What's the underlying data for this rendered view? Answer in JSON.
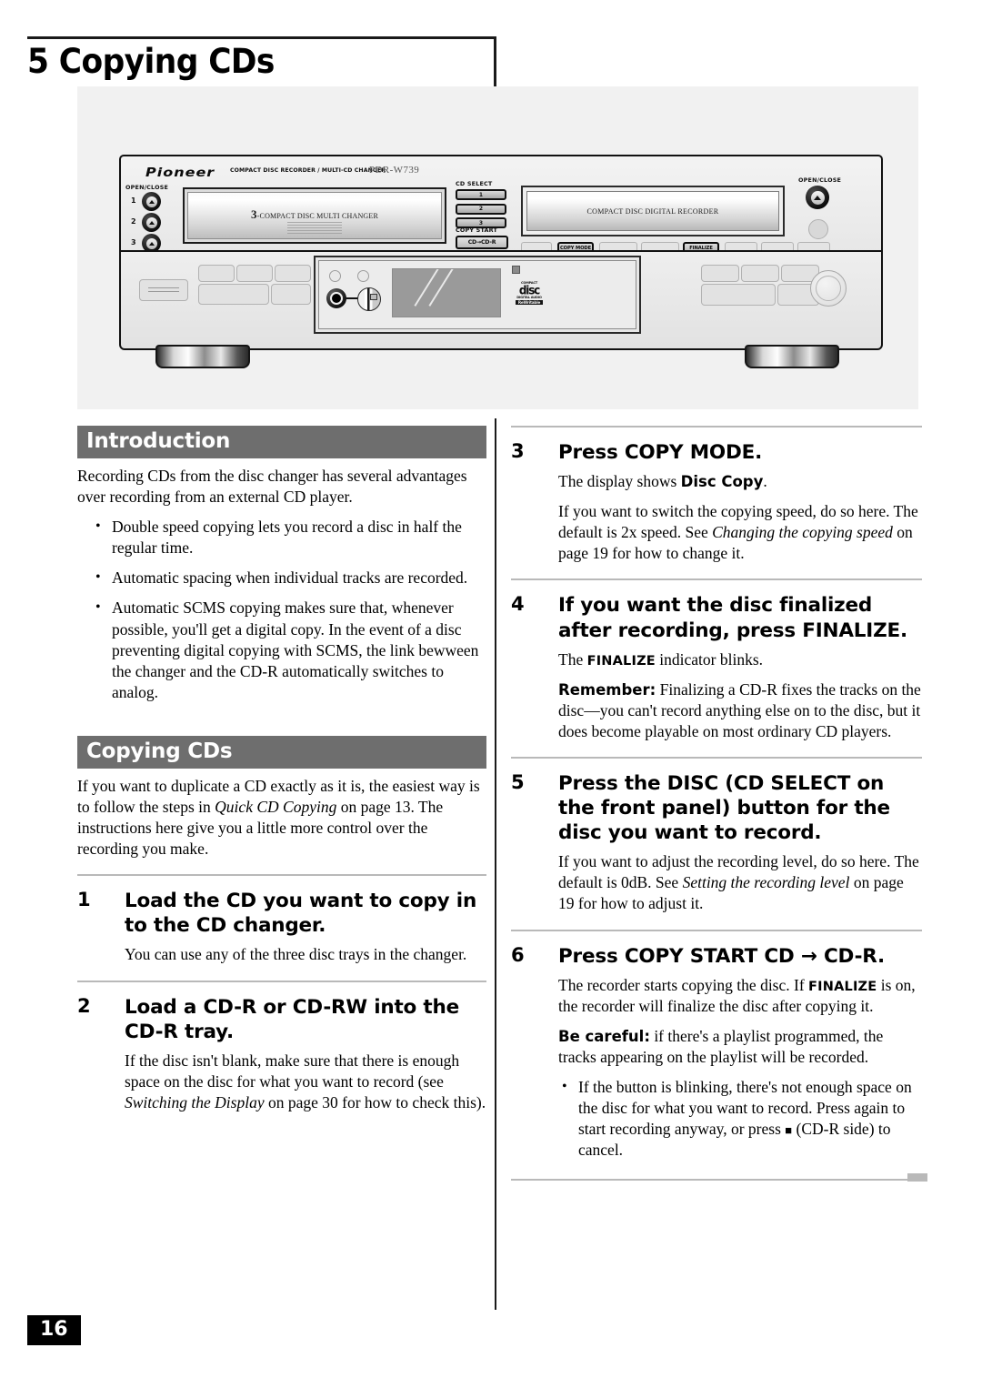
{
  "chapter": {
    "number_and_title": "5 Copying CDs"
  },
  "illustration": {
    "brand": "Pioneer",
    "brand_subtitle": "COMPACT DISC RECORDER / MULTI-CD CHANGER",
    "model": "PDR-W739",
    "open_close_left_label": "OPEN/CLOSE",
    "tray_numbers": [
      "1",
      "2",
      "3"
    ],
    "changer_tray_prefix": "3",
    "changer_tray_label": "-COMPACT DISC MULTI CHANGER",
    "cd_select_label": "CD SELECT",
    "cd_select_buttons": [
      "1",
      "2",
      "3"
    ],
    "copy_start_label": "COPY START",
    "copy_start_button": "CD→CD-R",
    "recorder_tray_label": "COMPACT DISC DIGITAL RECORDER",
    "copy_mode_button": "COPY MODE",
    "finalize_button": "FINALIZE",
    "open_close_right_label": "OPEN/CLOSE",
    "cd_logo_top": "COMPACT",
    "cd_logo_main": "disc",
    "cd_logo_bottom": "DIGITAL AUDIO",
    "cd_logo_rewritable": "ReWritable"
  },
  "left_column": {
    "intro": {
      "heading": "Introduction",
      "paragraph": "Recording CDs from the disc changer has several advantages over recording from an external CD player.",
      "bullets": [
        "Double speed copying lets you record a disc in half the regular time.",
        "Automatic spacing when individual tracks are recorded.",
        "Automatic SCMS copying makes sure that, whenever possible, you'll get a digital copy. In the event of a disc preventing digital copying with SCMS, the link bewween the changer and the CD-R automatically switches to analog."
      ]
    },
    "copying": {
      "heading": "Copying CDs",
      "paragraph_part1": "If you want to duplicate a CD exactly as it is, the easiest way is to follow the steps in ",
      "paragraph_italic": "Quick CD Copying",
      "paragraph_part2": " on page 13. The instructions here give you a little more control over the recording you make."
    },
    "steps": [
      {
        "number": "1",
        "heading": "Load the CD you want to copy in to the CD changer.",
        "body": "You can use any of the three disc trays in the changer."
      },
      {
        "number": "2",
        "heading": "Load a CD-R or CD-RW into the CD-R tray.",
        "body_part1": "If the disc isn't blank, make sure that there is enough space on the disc for what you want to record (see ",
        "body_italic": "Switching the Display",
        "body_part2": " on page 30 for how to check this)."
      }
    ]
  },
  "right_column": {
    "steps": [
      {
        "number": "3",
        "heading": "Press COPY MODE.",
        "body1_part1": "The display shows ",
        "body1_bold": "Disc Copy",
        "body1_part2": ".",
        "body2_part1": "If you want to switch the copying speed, do so here. The default is 2x speed. See ",
        "body2_italic": "Changing the copying speed",
        "body2_part2": " on page 19 for how to change it."
      },
      {
        "number": "4",
        "heading": "If you want the disc finalized after recording, press FINALIZE.",
        "body1_part1": "The ",
        "body1_sc": "FINALIZE",
        "body1_part2": " indicator blinks.",
        "body2_bold": "Remember:",
        "body2_text": " Finalizing a CD-R fixes the tracks on the disc—you can't record anything else on to the disc, but it does become playable on most ordinary CD players."
      },
      {
        "number": "5",
        "heading": "Press the DISC (CD SELECT on the front panel) button for the disc you want to record.",
        "body1_part1": "If you want to adjust the recording level, do so here. The default is 0dB. See ",
        "body1_italic": "Setting the recording level",
        "body1_part2": " on page 19 for how to adjust it."
      },
      {
        "number": "6",
        "heading": "Press COPY START CD → CD-R.",
        "body1_part1": "The recorder starts copying the disc. If ",
        "body1_sc": "FINALIZE",
        "body1_part2": " is on, the recorder will finalize the disc after copying it.",
        "body2_bold": "Be careful:",
        "body2_text": " if there's a playlist programmed, the tracks appearing on the playlist will be recorded.",
        "bullet_part1": "If the button is blinking, there's not enough space on the disc for what you want to record. Press again to start recording anyway, or press ",
        "bullet_symbol": "■",
        "bullet_part2": " (CD-R side) to cancel."
      }
    ]
  },
  "footer": {
    "page_number": "16"
  },
  "colors": {
    "section_bar": "#6e6e6e",
    "page_number_bg": "#000000",
    "illustration_bg": "#f1f1f1",
    "rule": "#b9b9b9"
  }
}
